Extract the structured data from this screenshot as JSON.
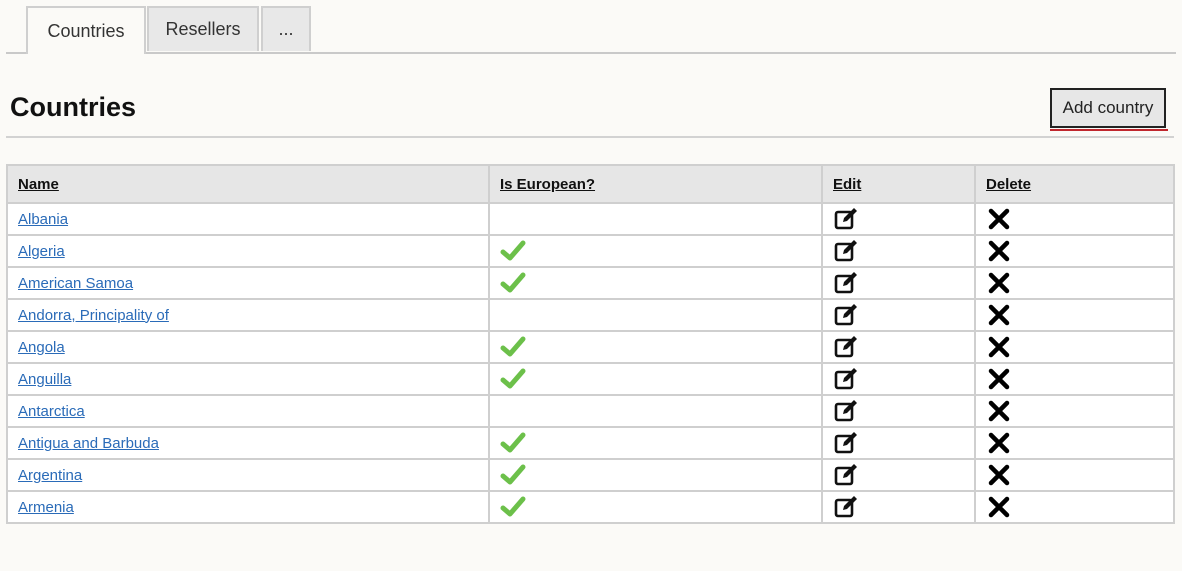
{
  "tabs": [
    {
      "label": "Countries",
      "active": true
    },
    {
      "label": "Resellers",
      "active": false
    },
    {
      "label": "...",
      "active": false
    }
  ],
  "page": {
    "title": "Countries",
    "add_button_label": "Add country"
  },
  "table": {
    "columns": [
      "Name",
      "Is European?",
      "Edit",
      "Delete"
    ],
    "rows": [
      {
        "name": "Albania",
        "is_european": false
      },
      {
        "name": "Algeria",
        "is_european": true
      },
      {
        "name": "American Samoa",
        "is_european": true
      },
      {
        "name": "Andorra, Principality of",
        "is_european": false
      },
      {
        "name": "Angola",
        "is_european": true
      },
      {
        "name": "Anguilla",
        "is_european": true
      },
      {
        "name": "Antarctica",
        "is_european": false
      },
      {
        "name": "Antigua and Barbuda",
        "is_european": true
      },
      {
        "name": "Argentina",
        "is_european": true
      },
      {
        "name": "Armenia",
        "is_european": true
      }
    ]
  },
  "colors": {
    "link": "#2a6bb8",
    "check": "#6cc04a",
    "accent_underline": "#c0272d"
  },
  "icons": {
    "european": "checkmark-icon",
    "edit": "edit-icon",
    "delete": "delete-x-icon"
  }
}
